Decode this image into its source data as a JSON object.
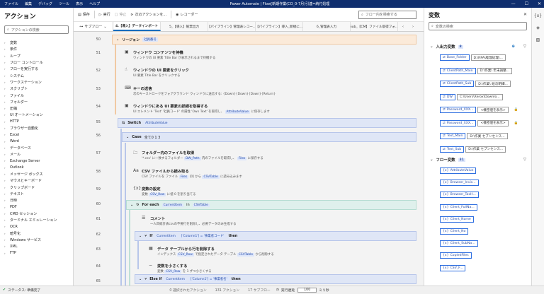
{
  "window": {
    "title": "Power Automate | Flow[新期作業(CO_0-7月)引連=納付処理",
    "controls": [
      "—",
      "☐",
      "✕"
    ]
  },
  "menu": [
    "ファイル",
    "編集",
    "デバッグ",
    "ツール",
    "表示",
    "ヘルプ"
  ],
  "left": {
    "title": "アクション",
    "search_placeholder": "アクションの検索",
    "items": [
      "変数",
      "条件",
      "ループ",
      "フロー コントロール",
      "フローを実行する",
      "システム",
      "ワークステーション",
      "スクリプト",
      "ファイル",
      "フォルダー",
      "圧縮",
      "UI オートメーション",
      "HTTP",
      "ブラウザー自動化",
      "Excel",
      "Word",
      "データベース",
      "メール",
      "Exchange Server",
      "Outlook",
      "メッセージ ボックス",
      "マウスとキーボード",
      "クリップボード",
      "テキスト",
      "日時",
      "PDF",
      "CMD セッション",
      "ターミナル エミュレーション",
      "OCR",
      "暗号化",
      "Windows サービス",
      "XML",
      "FTP"
    ]
  },
  "toolbar": {
    "save": "保存",
    "run": "実行",
    "stop": "停止",
    "next": "次のアクションを...",
    "recorder": "レコーダー",
    "search_placeholder": "フロー内を検索する"
  },
  "tabs": {
    "subflow": "サブフロー",
    "items": [
      "4.【導入】データインポート",
      "5_【導入】帳票出力",
      "【パイプライン】管理表レコー...",
      "【パイプライン】導入_新規に...",
      "6_管理表入力",
      "Sub_【CM】ファイル取得フォ..."
    ]
  },
  "lines": [
    "50",
    "51",
    "52",
    "53",
    "54",
    "55",
    "56",
    "57",
    "58",
    "59",
    "60",
    "61",
    "62",
    "63",
    "64",
    "65"
  ],
  "actions": {
    "region": {
      "label": "リージョン",
      "chip": "社員番号"
    },
    "a51": {
      "title": "ウィンドウ コンテンツを待機",
      "desc": "ウィンドウの UI 要素 Title Bar が表示されるまで待機する"
    },
    "a52": {
      "title": "ウィンドウの UI 要素をクリック",
      "desc": "UI 要素 Title Bar をクリックする"
    },
    "a53": {
      "title": "キーの送信",
      "desc": "次のキーストロークをフォアグラウンド ウィンドウに送信する: {Down}{Down}{Down}{Return}"
    },
    "a54": {
      "title": "ウィンドウにある UI 要素の詳細を取得する",
      "desc": "UI エレメント 'Text' '社員コード' の属性 'Own Text' を取得し、",
      "chip": "AttributeValue",
      "tail": "に保存します"
    },
    "switch": {
      "label": "Switch",
      "chip": "AttributeValue"
    },
    "case": {
      "label": "Case",
      "val": "全て0 1 3"
    },
    "a57": {
      "title": "フォルダー内のファイルを取得",
      "desc": "'*.csv' に一致するフォルダー",
      "chip1": "DW_Path",
      "mid": "内のファイルを取得し、",
      "chip2": "Files",
      "tail": "に保存する"
    },
    "a58": {
      "title": "CSV ファイルから読み取る",
      "desc": "CSV ファイルを ファイル",
      "chip1": "Files",
      "mid": "[0] から",
      "chip2": "CSVTable",
      "tail": "に読み込みます"
    },
    "a59": {
      "title": "変数の設定",
      "desc": "変数",
      "chip": "CSV_Row",
      "tail": "に値 0 を割り当てる"
    },
    "foreach": {
      "label": "For each",
      "chip1": "CurrentItem",
      "in": "in",
      "chip2": "CSVTable"
    },
    "a61": {
      "title": "コメント",
      "desc": "一人目総計表csvの不要行を削除し、必要データのみ生成する"
    },
    "if1": {
      "label": "If",
      "chip": "CurrentItem",
      "cond": "['Column1'] = '事業者コード'",
      "then": "then"
    },
    "a63": {
      "title": "データ テーブルから行を削除する",
      "desc": "インデックス",
      "chip1": "CSV_Row",
      "mid": "で指定されたデータ テーブル",
      "chip2": "CSVTable",
      "tail": "から削除する"
    },
    "a64": {
      "title": "変数を小さくする",
      "desc": "変数",
      "chip": "CSV_Row",
      "tail": "を 1 ずつ小さくする"
    },
    "elseif": {
      "label": "Else if",
      "chip": "CurrentItem",
      "cond": "['Column1'] = '事業者名'",
      "then": "then"
    }
  },
  "right": {
    "title": "変数",
    "search_placeholder": "変数の検索",
    "io": {
      "label": "入出力変数",
      "count": "8",
      "vars": [
        {
          "name": "Base_Folder",
          "val": "D:\\RPA\\経理処理\\..."
        },
        {
          "name": "ClientPath_Main",
          "val": "D:\\作業\\ 年末調整..."
        },
        {
          "name": "ClientPath_Sub",
          "val": "D:\\作業\\ 給与明細..."
        },
        {
          "name": "DW",
          "val": "C:\\Users\\Xerox\\Downlo..."
        },
        {
          "name": "Password_XXX...",
          "val": "<機密値を表示>"
        },
        {
          "name": "Password_XXX...",
          "val": "<機密値を表示>"
        },
        {
          "name": "Text_Main",
          "val": "D:\\作業 セブンセンス..."
        },
        {
          "name": "Text_Sub",
          "val": "D:\\作業 セブンセンス..."
        }
      ]
    },
    "flow": {
      "label": "フロー変数",
      "count": "31",
      "vars": [
        "AttributeValue",
        "Browser_Invis...",
        "Browser_TaxH...",
        "Client_FullNa...",
        "Client_Name",
        "Client_No",
        "Client_SubNa...",
        "CopiedFiles",
        "CSV_F..."
      ]
    }
  },
  "status": {
    "ready": "ステータス: 準備完了",
    "selected": "0 選択されたアクション",
    "total": "131 アクション",
    "subflows": "17 サブフロー",
    "delay_label": "実行遅延",
    "delay": "100",
    "ms": "ミリ秒"
  }
}
